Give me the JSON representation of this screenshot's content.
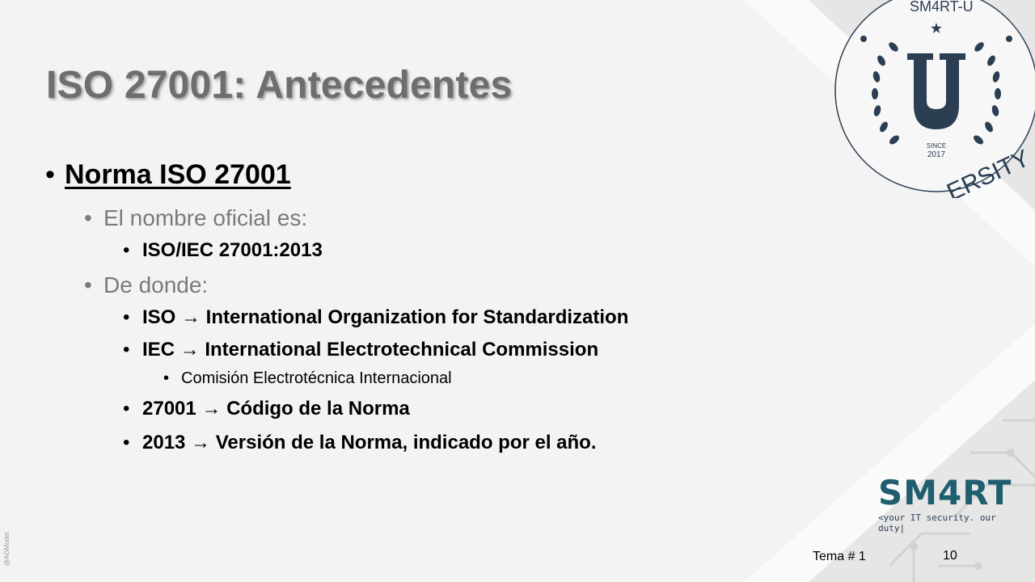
{
  "slide": {
    "title": "ISO 27001: Antecedentes",
    "bullets": {
      "main": "Norma ISO 27001",
      "official_intro": "El nombre oficial es:",
      "official_name": "ISO/IEC 27001:2013",
      "from_intro": "De donde:",
      "iso_line": "ISO → International Organization for Standardization",
      "iec_line": "IEC → International Electrotechnical Commission",
      "iec_translation": "Comisión Electrotécnica Internacional",
      "code_line": "27001 → Código de la Norma",
      "year_line": "2013 → Versión de la Norma, indicado por el año."
    },
    "bullet_char": "•"
  },
  "footer": {
    "topic": "Tema # 1",
    "page_number": "10",
    "credit": "@AGModel"
  },
  "logos": {
    "seal_top_text": "SM4RT-U",
    "seal_bottom_text": "ERSITY",
    "seal_letter": "U",
    "seal_since": "SINCE",
    "seal_year": "2017",
    "smart_text": "SM4RT",
    "smart_tagline": "<your IT security. our duty|"
  },
  "colors": {
    "navy": "#2b3e52",
    "teal": "#1f5e6e",
    "accent": "#8ab8c4",
    "title_gray": "#6e6e6e"
  }
}
